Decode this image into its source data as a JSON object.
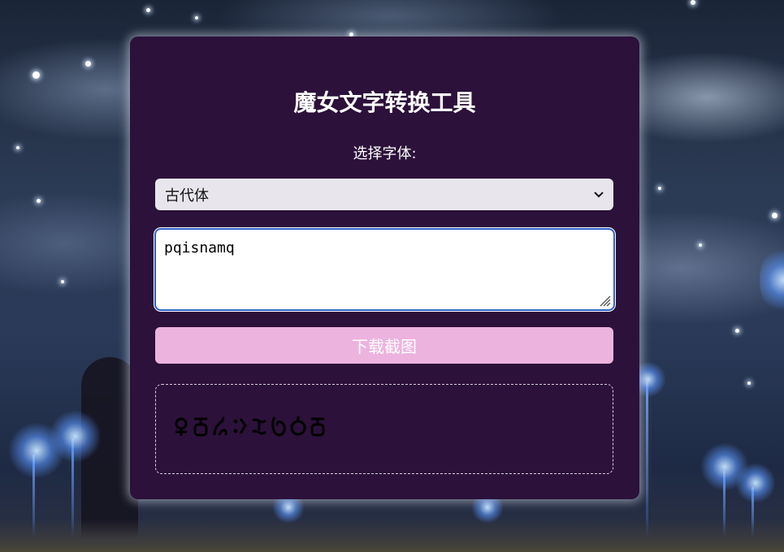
{
  "app": {
    "title": "魔女文字转换工具"
  },
  "font_select": {
    "label": "选择字体:",
    "selected": "古代体",
    "icon": "chevron-down-icon"
  },
  "input": {
    "value": "pqisnamq"
  },
  "download_button": {
    "label": "下载截图"
  },
  "preview": {
    "glyph_count": 8,
    "glyph_color": "#000000"
  },
  "colors": {
    "panel": "#2c113a",
    "button": "#ecb3df",
    "select_bg": "#e8e6ec",
    "focus_border": "#2f62c8"
  }
}
